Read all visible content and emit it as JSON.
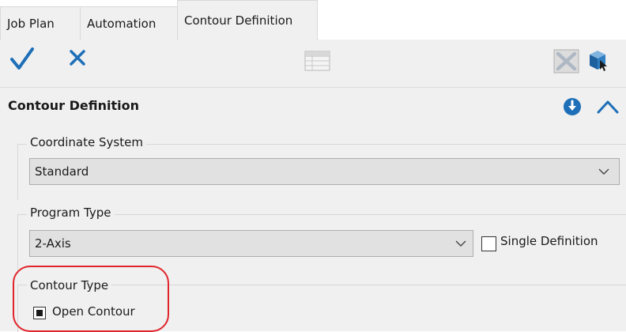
{
  "tabs": [
    {
      "label": "Job Plan",
      "active": false
    },
    {
      "label": "Automation",
      "active": false
    },
    {
      "label": "Contour Definition",
      "active": true
    }
  ],
  "toolbar": {
    "icons": [
      "checkmark-icon",
      "close-icon",
      "table-icon",
      "disabled-x-box-icon",
      "cube-select-icon"
    ]
  },
  "section": {
    "title": "Contour Definition",
    "icons": [
      "download-circle-icon",
      "chevron-up-icon"
    ]
  },
  "coordinate_system": {
    "label": "Coordinate System",
    "value": "Standard"
  },
  "program_type": {
    "label": "Program Type",
    "value": "2-Axis",
    "single_definition_label": "Single Definition",
    "single_definition_checked": false
  },
  "contour_type": {
    "label": "Contour Type",
    "option_label": "Open Contour",
    "option_state": "indeterminate"
  },
  "colors": {
    "accent_blue": "#1e6fb8",
    "highlight_red": "#e0242a",
    "panel_bg": "#f0f0f0"
  }
}
